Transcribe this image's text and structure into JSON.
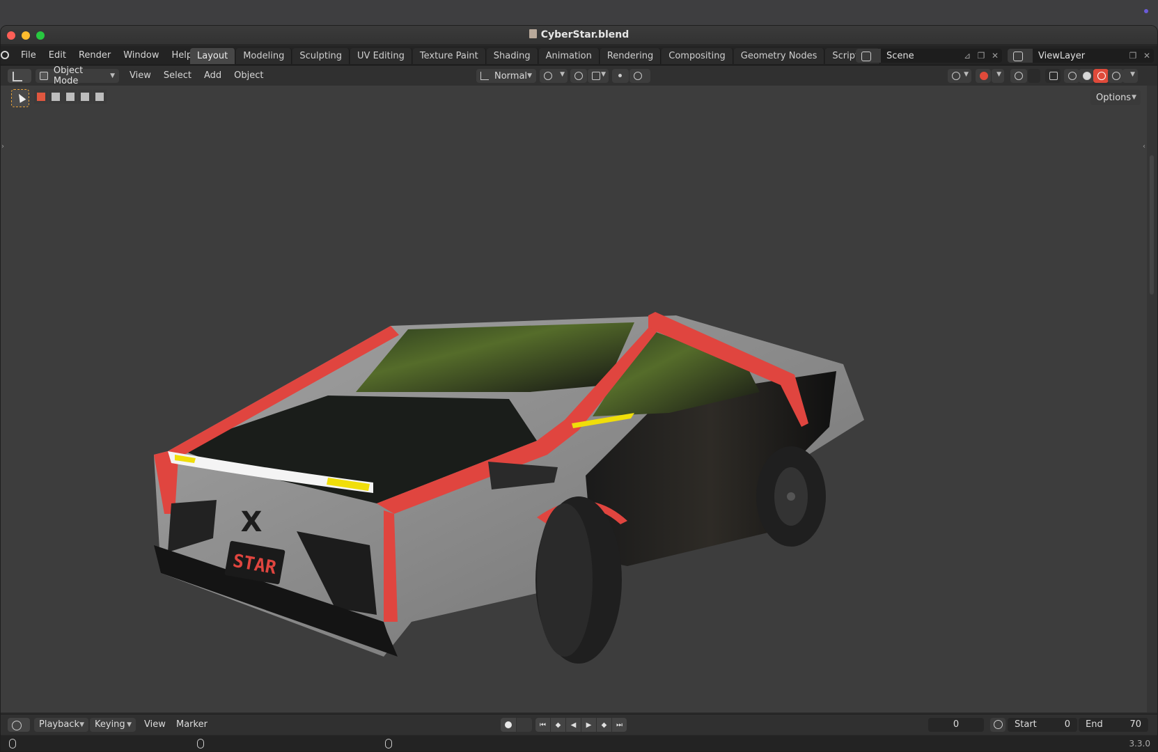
{
  "window": {
    "title": "CyberStar.blend"
  },
  "menus": [
    "File",
    "Edit",
    "Render",
    "Window",
    "Help"
  ],
  "workspaces": [
    "Layout",
    "Modeling",
    "Sculpting",
    "UV Editing",
    "Texture Paint",
    "Shading",
    "Animation",
    "Rendering",
    "Compositing",
    "Geometry Nodes",
    "Scripting"
  ],
  "workspace_add": "+",
  "scene": {
    "label": "Scene"
  },
  "view_layer": {
    "label": "ViewLayer"
  },
  "viewport_header": {
    "mode": "Object Mode",
    "menus": [
      "View",
      "Select",
      "Add",
      "Object"
    ],
    "orientation": "Normal",
    "options_label": "Options"
  },
  "car": {
    "plate_text": "STAR",
    "logo_text": "X",
    "colors": {
      "body_gray": "#8e8e8e",
      "accent_red": "#e0453f",
      "glass_black": "#141414",
      "headlight": "#f4f4f4",
      "headlight_yellow": "#f0de0a"
    }
  },
  "timeline": {
    "playback_label": "Playback",
    "keying_label": "Keying",
    "view_label": "View",
    "marker_label": "Marker",
    "current_frame": "0",
    "start_label": "Start",
    "start_value": "0",
    "end_label": "End",
    "end_value": "70"
  },
  "status": {
    "version": "3.3.0"
  }
}
